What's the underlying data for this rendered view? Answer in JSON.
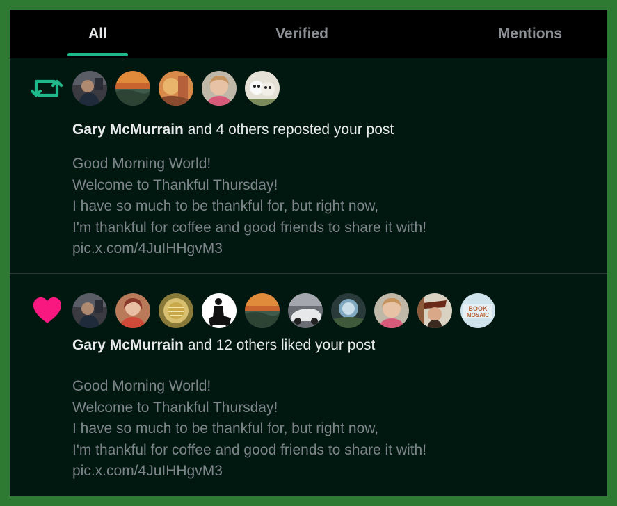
{
  "colors": {
    "page_background": "#2e7a33",
    "panel_background": "#011810",
    "tab_bar_background": "#000000",
    "tab_indicator": "#1fb88a",
    "repost_icon": "#1fb88a",
    "like_icon": "#f91880",
    "primary_text": "#e7e9ea",
    "secondary_text": "#7d8589"
  },
  "tabs": [
    {
      "label": "All",
      "selected": true
    },
    {
      "label": "Verified",
      "selected": false
    },
    {
      "label": "Mentions",
      "selected": false
    }
  ],
  "notifications": [
    {
      "type": "repost",
      "icon": "repost-icon",
      "avatar_count": 5,
      "actor_name": "Gary McMurrain",
      "action_text": " and 4 others reposted your post",
      "post_lines": [
        "Good Morning World!",
        "Welcome to Thankful Thursday!",
        "I have so much to be thankful for, but right now,",
        "I'm thankful for coffee and good friends to share it with!",
        "pic.x.com/4JuIHHgvM3"
      ]
    },
    {
      "type": "like",
      "icon": "heart-icon",
      "avatar_count": 10,
      "actor_name": "Gary McMurrain",
      "action_text": " and 12 others liked your post",
      "avatar_logo_text": [
        "BOOK",
        "MOSAIC"
      ],
      "post_lines": [
        "Good Morning World!",
        "Welcome to Thankful Thursday!",
        "I have so much to be thankful for, but right now,",
        "I'm thankful for coffee and good friends to share it with!",
        "pic.x.com/4JuIHHgvM3"
      ]
    }
  ]
}
